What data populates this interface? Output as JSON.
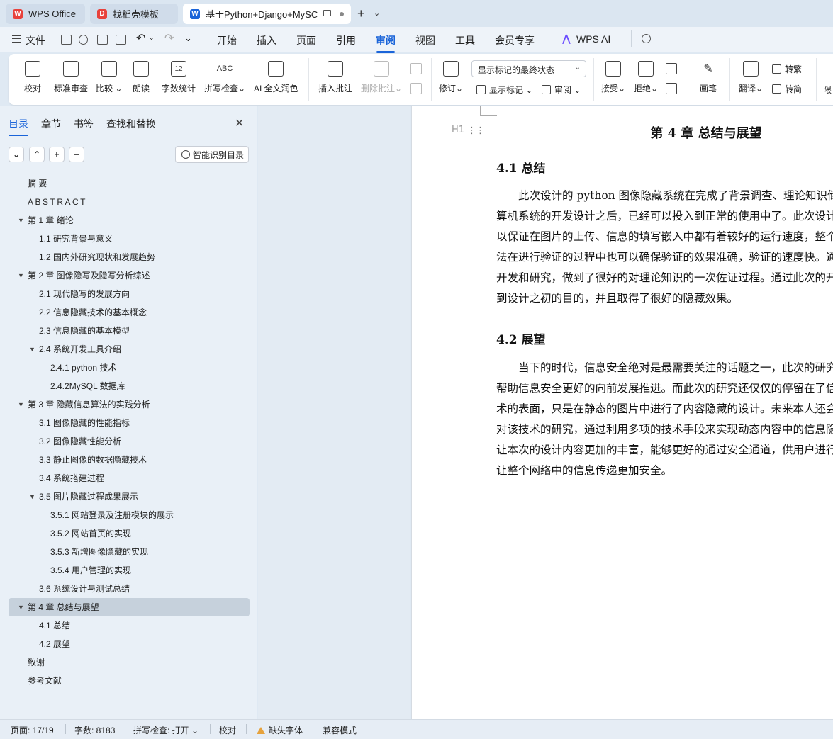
{
  "tabs": [
    {
      "label": "WPS Office",
      "logo": "W",
      "color": "#e8413b"
    },
    {
      "label": "找稻壳模板",
      "logo": "D",
      "color": "#e8413b"
    },
    {
      "label": "基于Python+Django+MySC",
      "logo": "W",
      "color": "#1a64d9"
    }
  ],
  "menu": {
    "file": "文件",
    "items": [
      "开始",
      "插入",
      "页面",
      "引用",
      "审阅",
      "视图",
      "工具",
      "会员专享"
    ],
    "active": "审阅",
    "wps_ai": "WPS AI"
  },
  "ribbon": {
    "proofread": "校对",
    "std_review": "标准审查",
    "compare": "比较",
    "read_aloud": "朗读",
    "word_count": "字数统计",
    "spell_check": "拼写检查",
    "ai_polish": "AI 全文润色",
    "insert_comment": "插入批注",
    "delete_comment": "删除批注",
    "track": "修订",
    "display_mode": "显示标记的最终状态",
    "show_markup": "显示标记",
    "review": "审阅",
    "accept": "接受",
    "reject": "拒绝",
    "pen": "画笔",
    "translate": "翻译",
    "to_traditional": "转繁",
    "to_simplified": "转简",
    "restrict": "限"
  },
  "nav": {
    "tabs": [
      "目录",
      "章节",
      "书签",
      "查找和替换"
    ],
    "smart_toc": "智能识别目录",
    "toc": [
      {
        "label": "摘  要",
        "level": 0,
        "toggle": ""
      },
      {
        "label": "ABSTRACT",
        "level": 0,
        "toggle": ""
      },
      {
        "label": "第 1 章  绪论",
        "level": 0,
        "toggle": "▼"
      },
      {
        "label": "1.1  研究背景与意义",
        "level": 1,
        "toggle": ""
      },
      {
        "label": "1.2  国内外研究现状和发展趋势",
        "level": 1,
        "toggle": ""
      },
      {
        "label": "第 2 章  图像隐写及隐写分析综述",
        "level": 0,
        "toggle": "▼"
      },
      {
        "label": "2.1  现代隐写的发展方向",
        "level": 1,
        "toggle": ""
      },
      {
        "label": "  2.2 信息隐藏技术的基本概念",
        "level": 1,
        "toggle": ""
      },
      {
        "label": "2.3 信息隐藏的基本模型",
        "level": 1,
        "toggle": ""
      },
      {
        "label": "2.4 系统开发工具介绍",
        "level": 1,
        "toggle": "▼"
      },
      {
        "label": "2.4.1 python 技术",
        "level": 2,
        "toggle": ""
      },
      {
        "label": "2.4.2MySQL 数据库",
        "level": 2,
        "toggle": ""
      },
      {
        "label": "第 3 章  隐藏信息算法的实践分析",
        "level": 0,
        "toggle": "▼"
      },
      {
        "label": "3.1  图像隐藏的性能指标",
        "level": 1,
        "toggle": ""
      },
      {
        "label": "3.2  图像隐藏性能分析",
        "level": 1,
        "toggle": ""
      },
      {
        "label": "3.3 静止图像的数据隐藏技术",
        "level": 1,
        "toggle": ""
      },
      {
        "label": "3.4  系统搭建过程",
        "level": 1,
        "toggle": ""
      },
      {
        "label": "3.5  图片隐藏过程成果展示",
        "level": 1,
        "toggle": "▼"
      },
      {
        "label": "3.5.1 网站登录及注册模块的展示",
        "level": 2,
        "toggle": ""
      },
      {
        "label": "3.5.2 网站首页的实现",
        "level": 2,
        "toggle": ""
      },
      {
        "label": "3.5.3 新增图像隐藏的实现",
        "level": 2,
        "toggle": ""
      },
      {
        "label": "3.5.4 用户管理的实现",
        "level": 2,
        "toggle": ""
      },
      {
        "label": "3.6 系统设计与测试总结",
        "level": 1,
        "toggle": ""
      },
      {
        "label": "第 4 章  总结与展望",
        "level": 0,
        "toggle": "▼",
        "selected": true
      },
      {
        "label": "4.1 总结",
        "level": 1,
        "toggle": ""
      },
      {
        "label": "4.2 展望",
        "level": 1,
        "toggle": ""
      },
      {
        "label": "致谢",
        "level": 0,
        "toggle": ""
      },
      {
        "label": "参考文献",
        "level": 0,
        "toggle": ""
      }
    ]
  },
  "doc": {
    "heading_marker": "H1",
    "drag_handle": "⋮⋮",
    "chapter_title": "第 4 章  总结与展望",
    "s1_title": "4.1 总结",
    "s1_lines": [
      "　　此次设计的 python 图像隐藏系统在完成了背景调查、理论知识储",
      "算机系统的开发设计之后，已经可以投入到正常的使用中了。此次设计",
      "以保证在图片的上传、信息的填写嵌入中都有着较好的运行速度，整个",
      "法在进行验证的过程中也可以确保验证的效果准确，验证的速度快。通",
      "开发和研究，做到了很好的对理论知识的一次佐证过程。通过此次的开",
      "到设计之初的目的，并且取得了很好的隐藏效果。"
    ],
    "s2_title": "4.2 展望",
    "s2_lines": [
      "　　当下的时代，信息安全绝对是最需要关注的话题之一，此次的研究",
      "帮助信息安全更好的向前发展推进。而此次的研究还仅仅的停留在了信",
      "术的表面，只是在静态的图片中进行了内容隐藏的设计。未来本人还会",
      "对该技术的研究，通过利用多项的技术手段来实现动态内容中的信息隐",
      "让本次的设计内容更加的丰富，能够更好的通过安全通道，供用户进行",
      "让整个网络中的信息传递更加安全。"
    ]
  },
  "status": {
    "page": "页面: 17/19",
    "words": "字数: 8183",
    "spell": "拼写检查: 打开",
    "proof": "校对",
    "missing_font": "缺失字体",
    "compat": "兼容模式"
  }
}
